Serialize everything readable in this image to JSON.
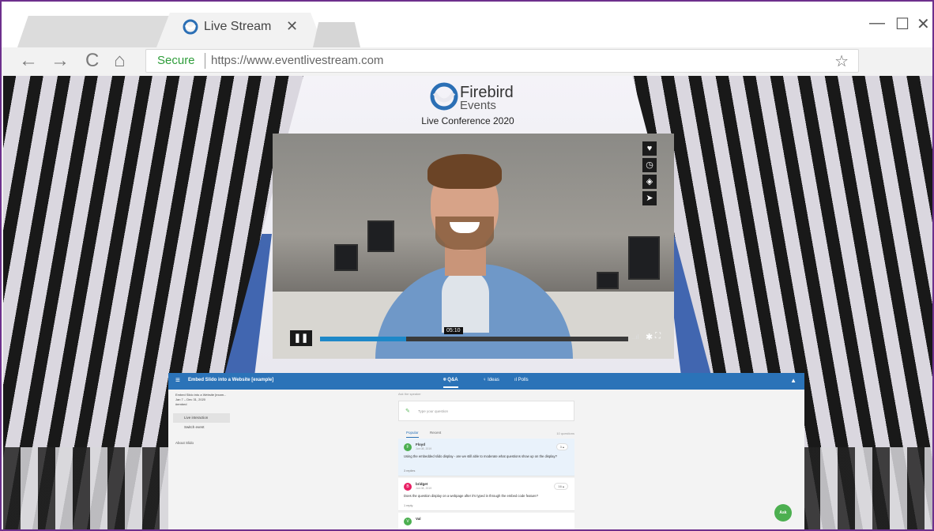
{
  "browser": {
    "tab": {
      "title": "Live Stream",
      "close": "✕"
    },
    "window_controls": {
      "minimize": "—",
      "maximize": "☐",
      "close": "✕"
    },
    "nav": {
      "back": "←",
      "forward": "→",
      "reload": "C",
      "home": "⌂"
    },
    "address": {
      "secure_label": "Secure",
      "url": "https://www.eventlivestream.com",
      "bookmark": "☆",
      "menu": "⋮"
    }
  },
  "page": {
    "logo": {
      "line1": "Firebird",
      "line2": "Events"
    },
    "subtitle": "Live Conference 2020",
    "player": {
      "side_icons": [
        "heart-icon",
        "clock-icon",
        "layers-icon",
        "send-icon"
      ],
      "pause_label": "❚❚",
      "time": "05:10",
      "progress": 0.28,
      "settings": "✱",
      "fullscreen": "⛶",
      "volume": "..ıl"
    },
    "slido": {
      "menu_icon": "≡",
      "title": "Embed Slido into a Website [example]",
      "tabs": [
        {
          "label": "Q&A"
        },
        {
          "label": "Ideas"
        },
        {
          "label": "Polls"
        }
      ],
      "user_icon": "▲",
      "event": {
        "name": "Embed Slido into a Website [exam...",
        "dates": "Jan 7 – Dec 31, 2020",
        "code": "#embed"
      },
      "nav": [
        {
          "label": "Live interaction"
        },
        {
          "label": "Switch event"
        }
      ],
      "about": "About Slido",
      "ask_hint": "Ask the speaker",
      "input_placeholder": "Type your question",
      "sort": {
        "popular": "Popular",
        "recent": "Recent"
      },
      "count": "10 questions",
      "questions": [
        {
          "initial": "F",
          "name": "Floyd",
          "date": "Jun 08, 2019",
          "likes": "3",
          "text": "Using the embedded slido display - are we still able to moderate what questions show up on the display?",
          "replies": "3 replies",
          "avatar_color": "#4caf50"
        },
        {
          "initial": "B",
          "name": "bridget",
          "date": "Jun 08, 2019",
          "likes": "16",
          "text": "Does the question display on a webpage after it's typed in through the embed code feature?",
          "replies": "1 reply",
          "avatar_color": "#e91e63"
        },
        {
          "initial": "V",
          "name": "Val",
          "date": "",
          "likes": "",
          "text": "",
          "replies": "",
          "avatar_color": "#4caf50"
        }
      ],
      "ask_button": "Ask"
    }
  },
  "colors": {
    "accent": "#2b73b8",
    "secure": "#2e9d3a",
    "frame": "#6d2f8c",
    "ask": "#4caf50"
  }
}
